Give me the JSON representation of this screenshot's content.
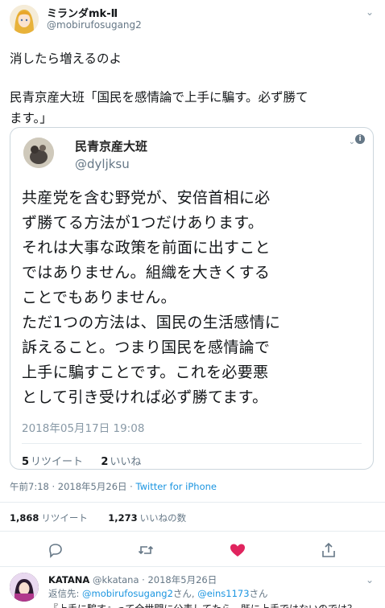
{
  "tweet": {
    "display_name": "ミランダmk-Ⅱ",
    "handle": "@mobirufosugang2",
    "text_line1": "消したら増えるのよ",
    "text_line2": "民青京産大班「国民を感情論で上手に騙す。必ず勝て",
    "text_line3": "ます。」"
  },
  "quoted": {
    "name": "民青京産大班",
    "handle": "@dyljksu",
    "body": [
      "共産党を含む野党が、安倍首相に必",
      "ず勝てる方法が1つだけあります。",
      "それは大事な政策を前面に出すこと",
      "ではありません。組織を大きくする",
      "ことでもありません。",
      "ただ1つの方法は、国民の生活感情に",
      "訴えること。つまり国民を感情論で",
      "上手に騙すことです。これを必要悪",
      "として引き受ければ必ず勝てます。"
    ],
    "date": "2018年05月17日 19:08",
    "retweet_count": "5",
    "retweet_label": "リツイート",
    "like_count": "2",
    "like_label": "いいね"
  },
  "meta": {
    "time": "午前7:18 · 2018年5月26日 · ",
    "client": "Twitter for iPhone"
  },
  "stats": {
    "retweet_count": "1,868",
    "retweet_label": "リツイート",
    "like_count": "1,273",
    "like_label": "いいねの数"
  },
  "actions": {
    "reply_icon": "reply-icon",
    "retweet_icon": "retweet-icon",
    "like_icon": "heart-icon",
    "share_icon": "share-icon",
    "like_color": "#e0245e"
  },
  "reply": {
    "name": "KATANA",
    "handle": "@kkatana",
    "date": " · 2018年5月26日",
    "reply_to_label": "返信先: ",
    "reply_to_user1": "@mobirufosugang2",
    "reply_to_mid": "さん, ",
    "reply_to_user2": "@eins1173",
    "reply_to_end": "さん",
    "text": "『上手に騙す』って全世間に公表してたら、既に上手ではないのでは？"
  }
}
